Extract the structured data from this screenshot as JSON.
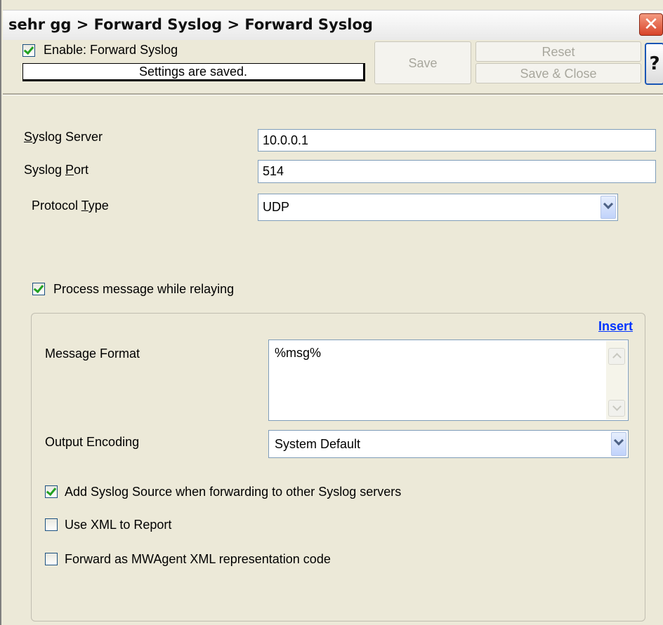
{
  "window": {
    "title": "sehr gg > Forward Syslog > Forward Syslog",
    "close_icon": "close-icon"
  },
  "header": {
    "enable_label": "Enable: Forward Syslog",
    "enable_checked": true,
    "status_text": "Settings are saved.",
    "save_label": "Save",
    "reset_label": "Reset",
    "save_close_label": "Save & Close",
    "help_label": "?"
  },
  "form": {
    "syslog_server": {
      "label_prefix": "",
      "label_mnemonic": "S",
      "label_rest": "yslog Server",
      "value": "10.0.0.1"
    },
    "syslog_port": {
      "label_prefix": "Syslog ",
      "label_mnemonic": "P",
      "label_rest": "ort",
      "value": "514"
    },
    "protocol_type": {
      "label_prefix": "Protocol ",
      "label_mnemonic": "T",
      "label_rest": "ype",
      "value": "UDP"
    },
    "process_message": {
      "label": "Process message while relaying",
      "checked": true
    }
  },
  "group": {
    "insert_label": "Insert",
    "message_format_label": "Message Format",
    "message_format_value": "%msg%",
    "output_encoding_label": "Output Encoding",
    "output_encoding_value": "System Default",
    "options": [
      {
        "label": "Add Syslog Source when forwarding to other Syslog servers",
        "checked": true
      },
      {
        "label": "Use XML to Report",
        "checked": false
      },
      {
        "label": "Forward as MWAgent XML representation code",
        "checked": false
      }
    ]
  }
}
